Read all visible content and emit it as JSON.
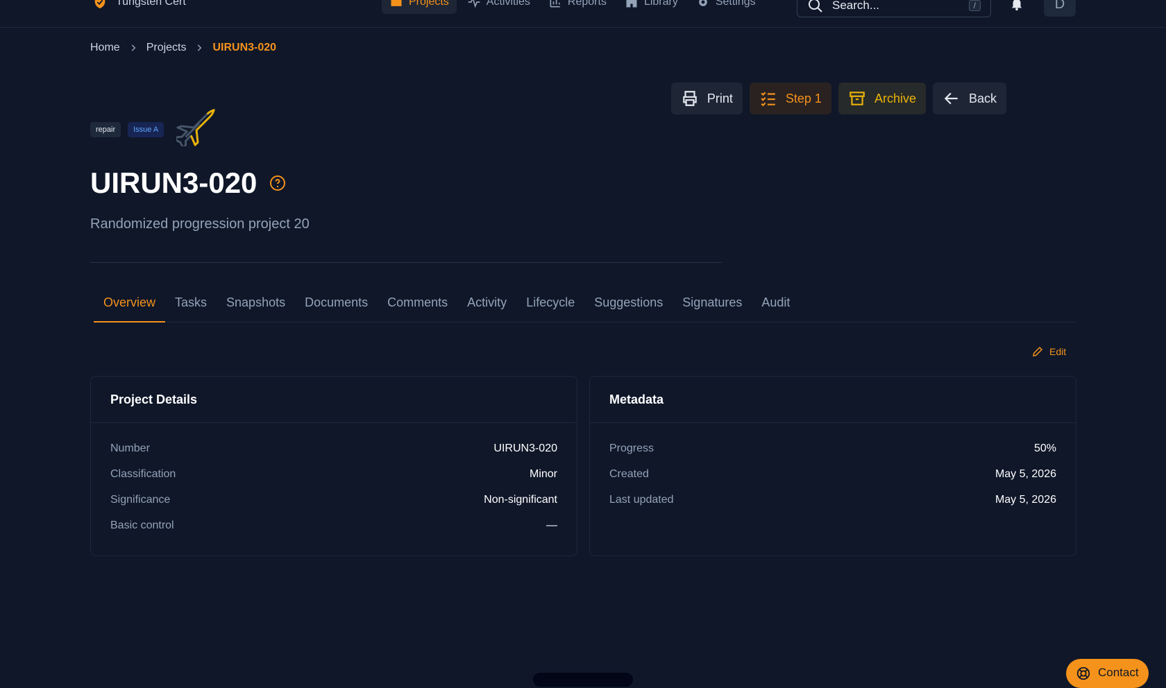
{
  "brand": {
    "name": "Tungsten Cert"
  },
  "nav": {
    "items": [
      {
        "label": "Projects",
        "icon": "folder-icon"
      },
      {
        "label": "Activities",
        "icon": "pulse-icon"
      },
      {
        "label": "Reports",
        "icon": "bar-chart-icon"
      },
      {
        "label": "Library",
        "icon": "building-icon"
      },
      {
        "label": "Settings",
        "icon": "gear-icon"
      }
    ]
  },
  "search": {
    "placeholder": "Search...",
    "shortcut": "/"
  },
  "user": {
    "initial": "D"
  },
  "breadcrumb": {
    "home": "Home",
    "projects": "Projects",
    "current": "UIRUN3-020"
  },
  "actions": {
    "print": "Print",
    "step": "Step 1",
    "archive": "Archive",
    "back": "Back"
  },
  "tags": {
    "repair": "repair",
    "issue": "Issue A"
  },
  "project": {
    "title": "UIRUN3-020",
    "subtitle": "Randomized progression project 20"
  },
  "tabs": [
    "Overview",
    "Tasks",
    "Snapshots",
    "Documents",
    "Comments",
    "Activity",
    "Lifecycle",
    "Suggestions",
    "Signatures",
    "Audit"
  ],
  "edit_label": "Edit",
  "details": {
    "title": "Project Details",
    "rows": [
      {
        "k": "Number",
        "v": "UIRUN3-020"
      },
      {
        "k": "Classification",
        "v": "Minor"
      },
      {
        "k": "Significance",
        "v": "Non-significant"
      },
      {
        "k": "Basic control",
        "v": "—"
      }
    ]
  },
  "metadata": {
    "title": "Metadata",
    "rows": [
      {
        "k": "Progress",
        "v": "50%"
      },
      {
        "k": "Created",
        "v": "May 5, 2026"
      },
      {
        "k": "Last updated",
        "v": "May 5, 2026"
      }
    ]
  },
  "contact": {
    "label": "Contact"
  },
  "colors": {
    "accent": "#f5921b",
    "background": "#0f1729",
    "issue_tag": "#60a5fa",
    "archive": "#eab308"
  }
}
